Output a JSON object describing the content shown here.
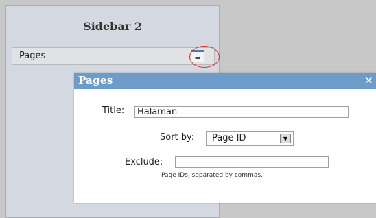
{
  "sidebar": {
    "title": "Sidebar 2"
  },
  "widget": {
    "label": "Pages",
    "handle_icon": "menu-icon"
  },
  "dialog": {
    "title": "Pages",
    "close_symbol": "×",
    "title_label": "Title:",
    "title_value": "Halaman",
    "sort_label": "Sort by:",
    "sort_value": "Page ID",
    "exclude_label": "Exclude:",
    "exclude_value": "",
    "exclude_hint": "Page IDs, separated by commas."
  },
  "colors": {
    "header": "#6d9cc9",
    "highlight_circle": "#d0302a"
  }
}
